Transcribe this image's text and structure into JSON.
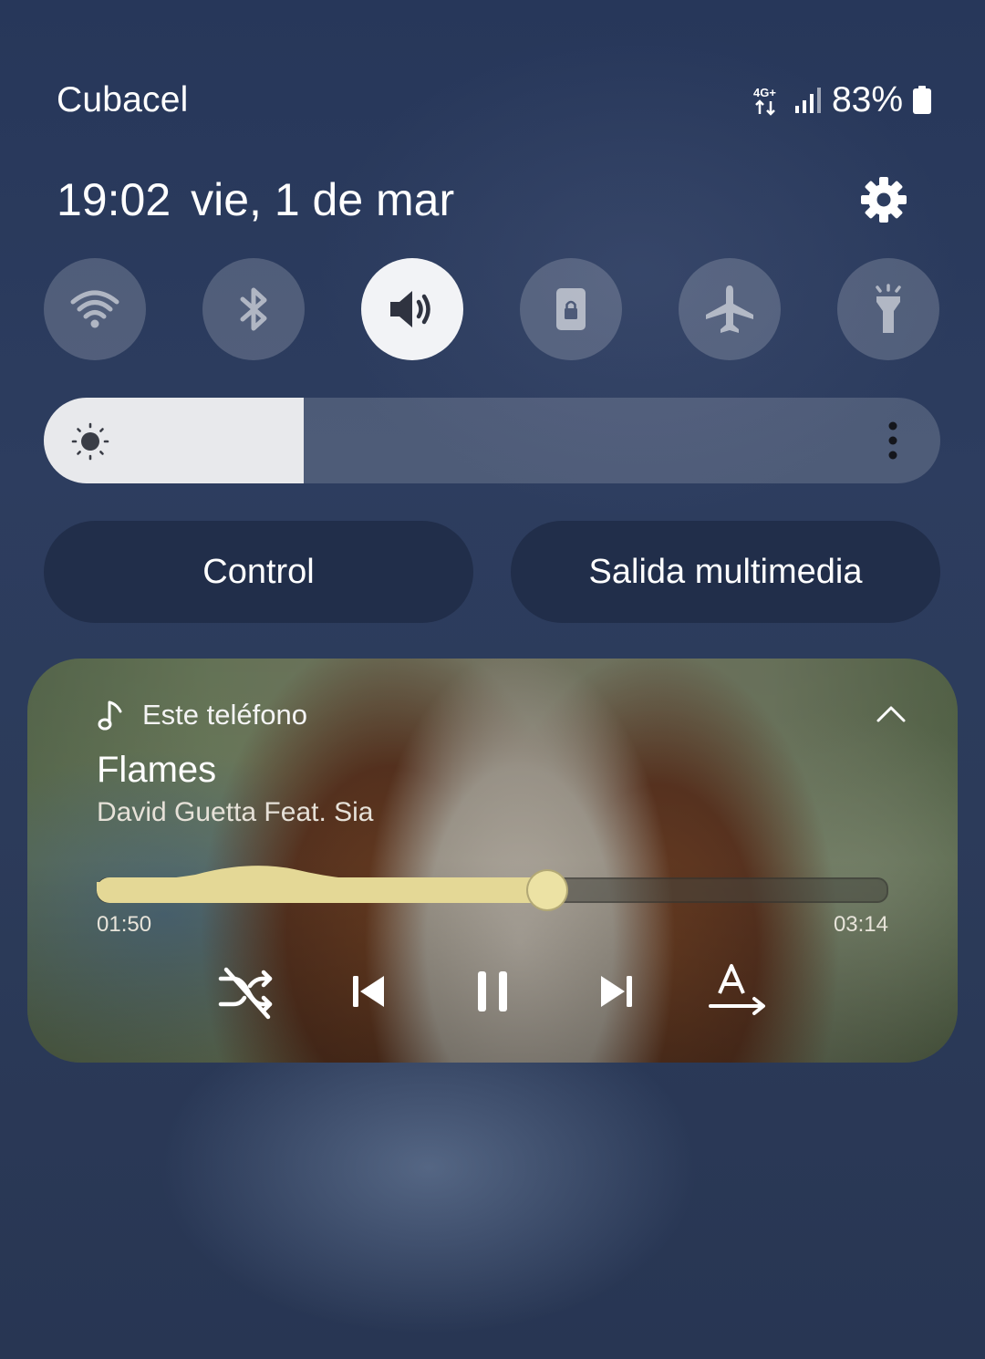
{
  "status_bar": {
    "carrier": "Cubacel",
    "network_type": "4G+",
    "battery": "83%",
    "icons": [
      "network-4g-icon",
      "signal-icon",
      "battery-icon"
    ]
  },
  "header": {
    "time": "19:02",
    "date": "vie, 1 de mar",
    "settings_icon": "gear-icon"
  },
  "quick_toggles": [
    {
      "name": "wifi",
      "icon": "wifi-icon",
      "active": false
    },
    {
      "name": "bluetooth",
      "icon": "bluetooth-icon",
      "active": false
    },
    {
      "name": "sound",
      "icon": "volume-icon",
      "active": true
    },
    {
      "name": "rotation-lock",
      "icon": "lock-icon",
      "active": false
    },
    {
      "name": "airplane-mode",
      "icon": "airplane-icon",
      "active": false
    },
    {
      "name": "flashlight",
      "icon": "flashlight-icon",
      "active": false
    }
  ],
  "brightness": {
    "level": 0.29,
    "icon": "sun-icon",
    "menu_icon": "more-vertical-icon"
  },
  "buttons": {
    "control": "Control",
    "media_output": "Salida multimedia"
  },
  "media": {
    "source": "Este teléfono",
    "title": "Flames",
    "artist": "David Guetta Feat. Sia",
    "elapsed": "01:50",
    "total": "03:14",
    "progress": 0.567,
    "controls": [
      "shuffle-icon",
      "previous-icon",
      "pause-icon",
      "next-icon",
      "lyrics-icon"
    ]
  },
  "colors": {
    "toggle_on": "#f2f3f6",
    "accent_seek": "#e4d896"
  }
}
